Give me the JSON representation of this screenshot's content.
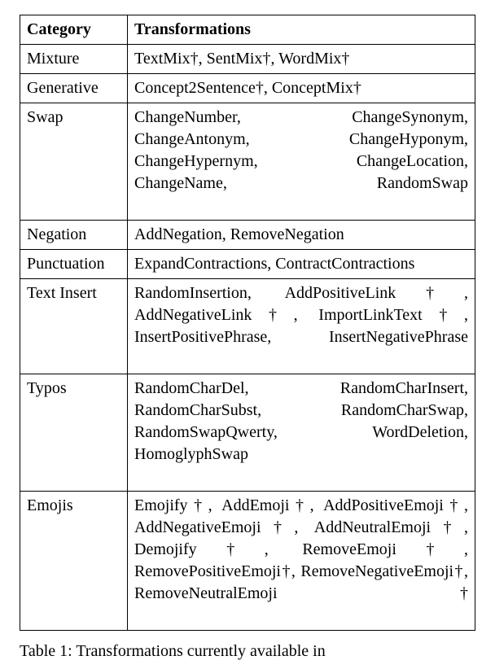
{
  "table": {
    "headers": {
      "category": "Category",
      "transformations": "Transformations"
    },
    "rows": [
      {
        "category": "Mixture",
        "transformations": "TextMix†, SentMix†, WordMix†"
      },
      {
        "category": "Generative",
        "transformations": "Concept2Sentence†, ConceptMix†"
      },
      {
        "category": "Swap",
        "transformations": "ChangeNumber, ChangeSynonym, ChangeAntonym, ChangeHyponym, ChangeHypernym, ChangeLocation, ChangeName, RandomSwap"
      },
      {
        "category": "Negation",
        "transformations": "AddNegation, RemoveNegation"
      },
      {
        "category": "Punctuation",
        "transformations": "ExpandContractions, ContractContractions"
      },
      {
        "category": "Text Insert",
        "transformations": "RandomInsertion, AddPositiveLink†, AddNegativeLink†, ImportLinkText†, InsertPositivePhrase, InsertNegativePhrase"
      },
      {
        "category": "Typos",
        "transformations": "RandomCharDel, RandomCharInsert, RandomCharSubst, RandomCharSwap, RandomSwapQwerty, WordDeletion, HomoglyphSwap"
      },
      {
        "category": "Emojis",
        "transformations": "Emojify†, AddEmoji†, AddPositiveEmoji†, AddNegativeEmoji†, AddNeutralEmoji†, Demojify†, RemoveEmoji†, RemovePositiveEmoji†, RemoveNegativeEmoji†, RemoveNeutralEmoji†"
      }
    ]
  },
  "caption_prefix": "Table 1: Transformations currently available in"
}
